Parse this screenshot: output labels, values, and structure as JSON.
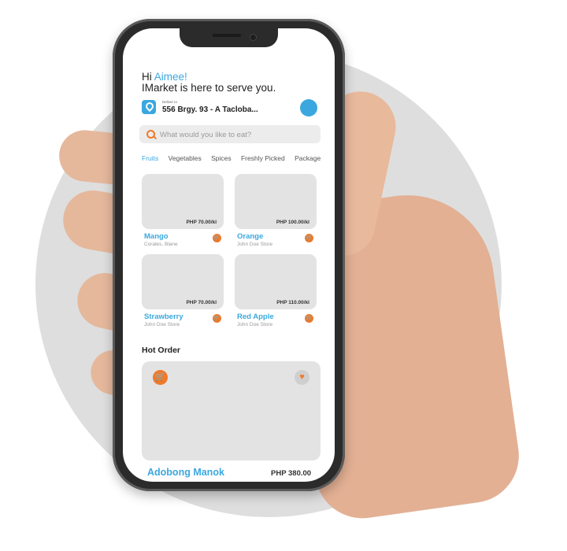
{
  "greeting": {
    "hi": "Hi",
    "name": "Aimee!",
    "subtitle": "IMarket is here to serve you."
  },
  "delivery": {
    "label": "Deliver to",
    "address": "556 Brgy. 93 - A Tacloba..."
  },
  "search": {
    "placeholder": "What would you like to eat?"
  },
  "categories": [
    "Fruits",
    "Vegetables",
    "Spices",
    "Freshly Picked",
    "Package"
  ],
  "products": [
    {
      "name": "Mango",
      "store": "Corales, Blane",
      "price": "PHP 70.00/kl"
    },
    {
      "name": "Orange",
      "store": "John Doe Store",
      "price": "PHP 100.00/kl"
    },
    {
      "name": "Strawberry",
      "store": "John Doe Store",
      "price": "PHP 70.00/kl"
    },
    {
      "name": "Red Apple",
      "store": "John Doe Store",
      "price": "PHP 110.00/kl"
    }
  ],
  "hot_order": {
    "section_title": "Hot Order",
    "name": "Adobong Manok",
    "price": "PHP 380.00"
  },
  "colors": {
    "accent": "#3aa8df",
    "cart": "#f07a2a",
    "card": "#e3e3e3"
  },
  "icons": {
    "location": "location-pin-icon",
    "search": "search-icon",
    "cart": "cart-icon",
    "heart": "heart-icon"
  }
}
